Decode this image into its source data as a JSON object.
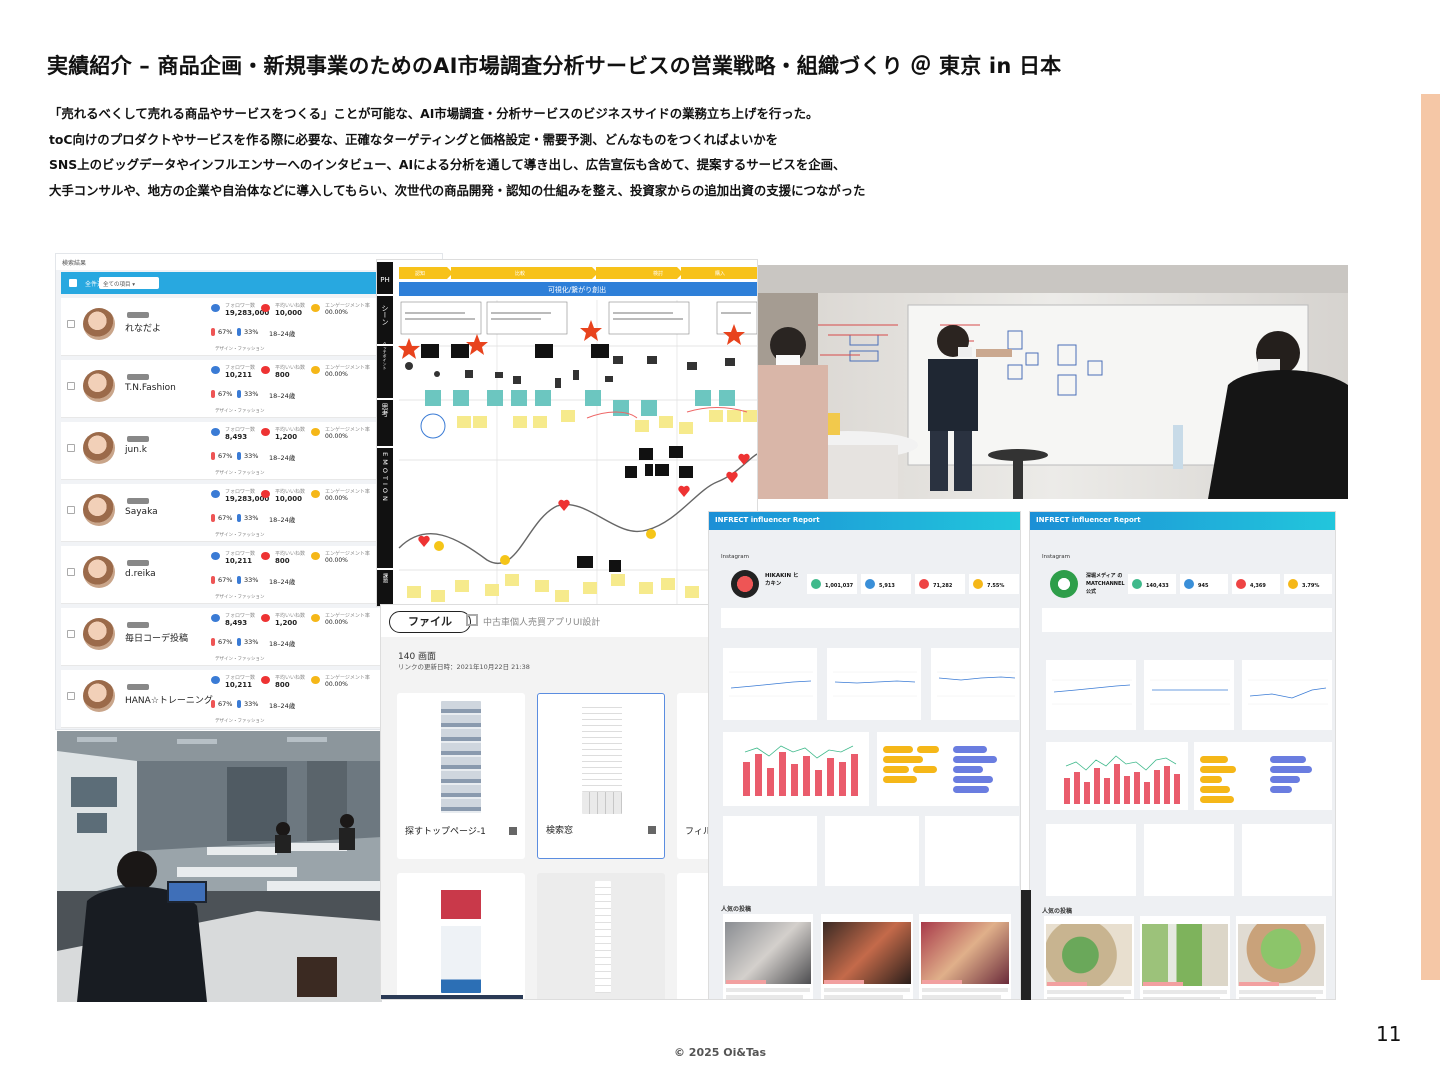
{
  "slide": {
    "title": "実績紹介 – 商品企画・新規事業のためのAI市場調査分析サービスの営業戦略・組織づくり ＠ 東京 in 日本",
    "description": [
      "「売れるべくして売れる商品やサービスをつくる」ことが可能な、AI市場調査・分析サービスのビジネスサイドの業務立ち上げを行った。",
      "toC向けのプロダクトやサービスを作る際に必要な、正確なターゲティングと価格設定・需要予測、どんなものをつくればよいかを",
      "SNS上のビッグデータやインフルエンサーへのインタビュー、AIによる分析を通して導き出し、広告宣伝も含めて、提案するサービスを企画、",
      "大手コンサルや、地方の企業や自治体などに導入してもらい、次世代の商品開発・認知の仕組みを整え、投資家からの追加出資の支援につながった"
    ],
    "page_number": "11",
    "copyright": "© 2025 Oi&Tas",
    "accent_color": "#f5c7a6"
  },
  "influencer_list": {
    "top_label": "検索結果",
    "select_label": "全ての項目",
    "header_check_label": "全件選択",
    "header_color": "#28a8e0",
    "stat_labels": [
      "フォロワー数",
      "平均いいね数",
      "エンゲージメント率"
    ],
    "rows": [
      {
        "name": "れなだよ",
        "followers": "19,283,000",
        "likes": "10,000",
        "engagement": "00.00%",
        "female": "67%",
        "male": "33%",
        "age": "18–24歳"
      },
      {
        "name": "T.N.Fashion",
        "followers": "10,211",
        "likes": "800",
        "engagement": "00.00%",
        "female": "67%",
        "male": "33%",
        "age": "18–24歳"
      },
      {
        "name": "jun.k",
        "followers": "8,493",
        "likes": "1,200",
        "engagement": "00.00%",
        "female": "67%",
        "male": "33%",
        "age": "18–24歳"
      },
      {
        "name": "Sayaka",
        "followers": "19,283,000",
        "likes": "10,000",
        "engagement": "00.00%",
        "female": "67%",
        "male": "33%",
        "age": "18–24歳"
      },
      {
        "name": "d.reika",
        "followers": "10,211",
        "likes": "800",
        "engagement": "00.00%",
        "female": "67%",
        "male": "33%",
        "age": "18–24歳"
      },
      {
        "name": "毎日コーデ投稿",
        "followers": "8,493",
        "likes": "1,200",
        "engagement": "00.00%",
        "female": "67%",
        "male": "33%",
        "age": "18–24歳"
      },
      {
        "name": "HANA☆トレーニング",
        "followers": "10,211",
        "likes": "800",
        "engagement": "00.00%",
        "female": "67%",
        "male": "33%",
        "age": "18–24歳"
      }
    ],
    "tags_label": "デザイン・ファッション"
  },
  "journey_map": {
    "banner": "可視化/繋がり創出",
    "side_labels": [
      "PH",
      "シーン",
      "タッチポイント",
      "思考",
      "EMOTION",
      "課題"
    ],
    "phases": [
      "認知",
      "比較",
      "検討",
      "購入"
    ]
  },
  "app_design": {
    "tab_label": "ファイル",
    "project_name": "中古車個人売買アプリUI設計",
    "screen_count": "140 画面",
    "link_updated": "リンクの更新日時：2021年10月22日 21:38",
    "cards": [
      "探すトップページ-1",
      "検索窓",
      "フィル"
    ]
  },
  "report_1": {
    "logo": "INFRECT influencer Report",
    "platform": "Instagram",
    "account_name": "HIKAKIN ヒカキン",
    "stats": [
      "1,001,037",
      "5,913",
      "71,282",
      "7.55%"
    ],
    "section_popular": "人気の投稿"
  },
  "report_2": {
    "logo": "INFRECT influencer Report",
    "platform": "Instagram",
    "account_name": "深堀メディア の MATCHANNEL 公式",
    "stats": [
      "140,433",
      "945",
      "4,369",
      "3.79%"
    ],
    "section_popular": "人気の投稿"
  }
}
